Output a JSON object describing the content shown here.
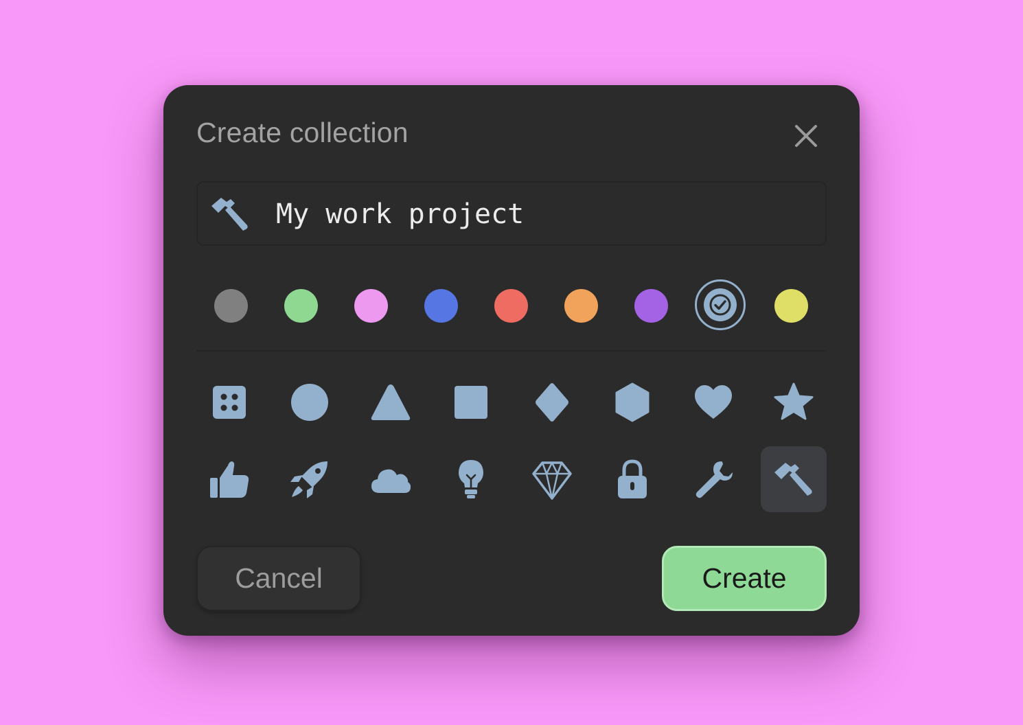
{
  "dialog": {
    "title": "Create collection",
    "close_icon": "close-icon"
  },
  "name_field": {
    "icon": "hammer-icon",
    "value": "My work project"
  },
  "colors": {
    "selected": "steel-blue",
    "swatches": [
      {
        "name": "gray",
        "hex": "#808080"
      },
      {
        "name": "green",
        "hex": "#8ed892"
      },
      {
        "name": "pink",
        "hex": "#ed99f0"
      },
      {
        "name": "blue",
        "hex": "#5677e3"
      },
      {
        "name": "red",
        "hex": "#ee6c61"
      },
      {
        "name": "orange",
        "hex": "#f2a35b"
      },
      {
        "name": "purple",
        "hex": "#a463e5"
      },
      {
        "name": "steel-blue",
        "hex": "#93b1cc"
      },
      {
        "name": "yellow",
        "hex": "#dfde66"
      }
    ]
  },
  "icons": {
    "selected": "hammer-icon",
    "tint": "#93b1cc",
    "row1": [
      "grid-icon",
      "circle-icon",
      "triangle-icon",
      "square-icon",
      "diamond-icon",
      "hexagon-icon",
      "heart-icon",
      "star-icon"
    ],
    "row2": [
      "thumbs-up-icon",
      "rocket-icon",
      "cloud-icon",
      "lightbulb-icon",
      "gem-icon",
      "lock-icon",
      "wrench-icon",
      "hammer-icon"
    ]
  },
  "actions": {
    "cancel_label": "Cancel",
    "create_label": "Create"
  }
}
